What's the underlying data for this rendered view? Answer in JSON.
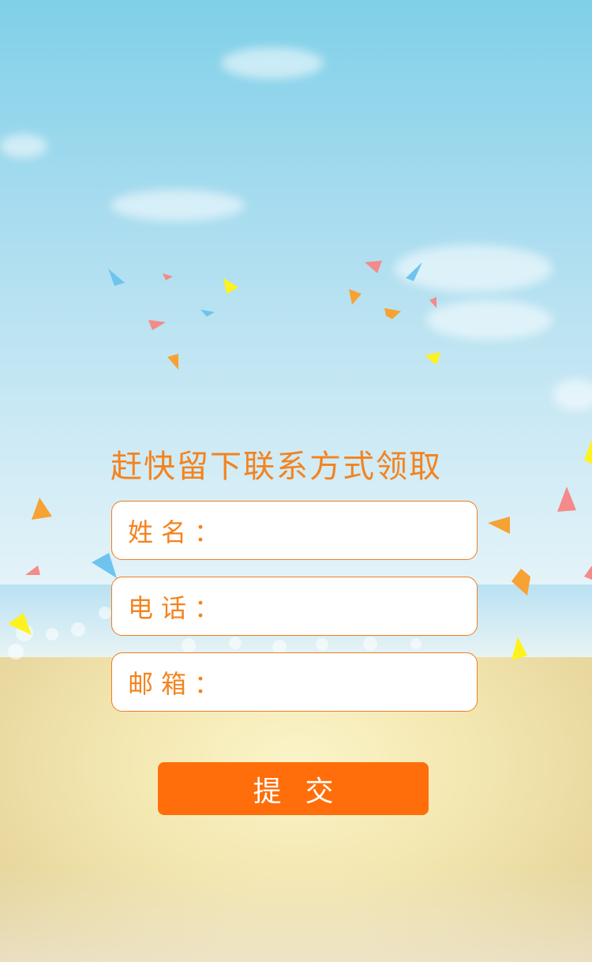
{
  "headline": "赶快留下联系方式领取",
  "form": {
    "fields": [
      {
        "label": "姓名：",
        "value": ""
      },
      {
        "label": "电话：",
        "value": ""
      },
      {
        "label": "邮箱：",
        "value": ""
      }
    ],
    "submit_label": "提交"
  },
  "colors": {
    "accent": "#ff6e0a",
    "text_orange": "#f3831f",
    "border": "#ef7d21"
  }
}
